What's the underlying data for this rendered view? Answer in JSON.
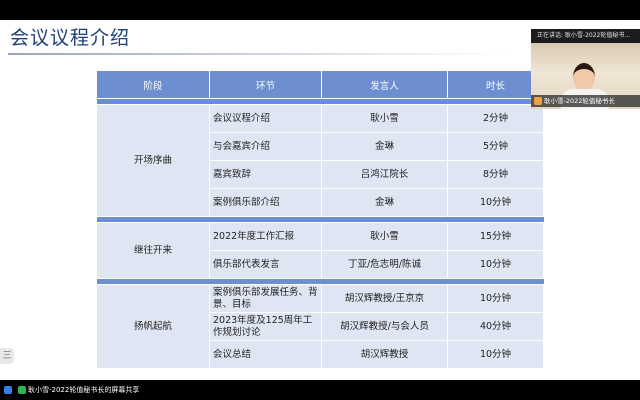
{
  "slide": {
    "title": "会议议程介绍",
    "table": {
      "headers": [
        "阶段",
        "环节",
        "发言人",
        "时长"
      ],
      "groups": [
        {
          "phase": "开场序曲",
          "rows": [
            {
              "item": "会议议程介绍",
              "speaker": "耿小雪",
              "duration": "2分钟"
            },
            {
              "item": "与会嘉宾介绍",
              "speaker": "金琳",
              "duration": "5分钟"
            },
            {
              "item": "嘉宾致辞",
              "speaker": "吕鸿江院长",
              "duration": "8分钟"
            },
            {
              "item": "案例俱乐部介绍",
              "speaker": "金琳",
              "duration": "10分钟"
            }
          ]
        },
        {
          "phase": "继往开来",
          "rows": [
            {
              "item": "2022年度工作汇报",
              "speaker": "耿小雪",
              "duration": "15分钟"
            },
            {
              "item": "俱乐部代表发言",
              "speaker": "丁亚/危志明/陈诚",
              "duration": "10分钟"
            }
          ]
        },
        {
          "phase": "扬帆起航",
          "rows": [
            {
              "item": "案例俱乐部发展任务、背景、目标",
              "speaker": "胡汉辉教授/王京京",
              "duration": "10分钟"
            },
            {
              "item": "2023年度及125周年工作规划讨论",
              "speaker": "胡汉辉教授/与会人员",
              "duration": "40分钟"
            },
            {
              "item": "会议总结",
              "speaker": "胡汉辉教授",
              "duration": "10分钟"
            }
          ]
        }
      ]
    }
  },
  "presenter": {
    "status": "正在讲话: 耿小雪-2022轮值秘书...",
    "name": "耿小雪-2022轮值秘书长"
  },
  "side_handle": {
    "label": "三"
  },
  "screen_share": {
    "label": "耿小雪-2022轮值秘书长的屏幕共享"
  },
  "colors": {
    "header": "#6e8fcf",
    "cell": "#dfe6f3",
    "title": "#1f3f7a"
  },
  "icons": [
    "screen-share-icon",
    "microphone-icon",
    "menu-icon"
  ]
}
